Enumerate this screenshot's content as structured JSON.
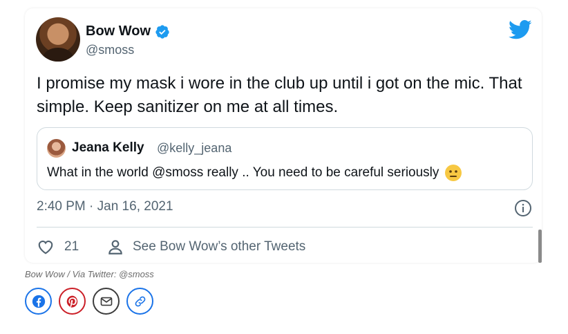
{
  "tweet": {
    "author_name": "Bow Wow",
    "author_handle": "@smoss",
    "text": "I promise my mask i wore in the club up until i got on the mic. That simple. Keep sanitizer on me at all times.",
    "timestamp": "2:40 PM · Jan 16, 2021",
    "like_count": "21",
    "other_tweets_label": "See Bow Wow’s other Tweets",
    "quote": {
      "author_name": "Jeana Kelly",
      "author_handle": "@kelly_jeana",
      "text": "What in the world @smoss really .. You need to be careful seriously",
      "emoji_icon": "neutral-face-emoji-icon"
    }
  },
  "caption": "Bow Wow / Via Twitter: @smoss",
  "share_buttons": [
    {
      "icon": "facebook-icon",
      "color": "#1a73e8"
    },
    {
      "icon": "pinterest-icon",
      "color": "#cb1f27"
    },
    {
      "icon": "email-icon",
      "color": "#3c3c3c"
    },
    {
      "icon": "link-icon",
      "color": "#1a73e8"
    }
  ],
  "colors": {
    "twitter_blue": "#1d9bf0",
    "text_primary": "#0f1419",
    "text_secondary": "#536471",
    "border": "#cfd9de"
  }
}
